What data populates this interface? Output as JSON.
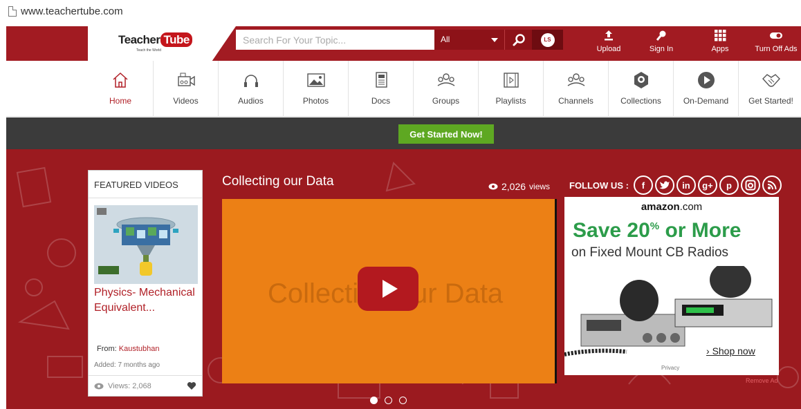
{
  "browser": {
    "url": "www.teachertube.com"
  },
  "header": {
    "logo_main": "Teacher",
    "logo_tube": "Tube",
    "logo_tagline": "Teach the World",
    "search_placeholder": "Search For Your Topic...",
    "search_category": "All",
    "ls_label": "LS",
    "actions": [
      {
        "label": "Upload",
        "icon": "upload-icon"
      },
      {
        "label": "Sign In",
        "icon": "key-icon"
      },
      {
        "label": "Apps",
        "icon": "grid-icon"
      },
      {
        "label": "Turn Off Ads",
        "icon": "toggle-icon"
      }
    ]
  },
  "nav": {
    "items": [
      {
        "label": "Home",
        "icon": "home-icon",
        "active": true
      },
      {
        "label": "Videos",
        "icon": "video-camera-icon"
      },
      {
        "label": "Audios",
        "icon": "headphones-icon"
      },
      {
        "label": "Photos",
        "icon": "photo-icon"
      },
      {
        "label": "Docs",
        "icon": "document-icon"
      },
      {
        "label": "Groups",
        "icon": "group-icon"
      },
      {
        "label": "Playlists",
        "icon": "film-icon"
      },
      {
        "label": "Channels",
        "icon": "channels-icon"
      },
      {
        "label": "Collections",
        "icon": "collection-icon"
      },
      {
        "label": "On-Demand",
        "icon": "play-circle-icon"
      },
      {
        "label": "Get Started!",
        "icon": "handshake-icon"
      }
    ]
  },
  "cta": {
    "label": "Get Started Now!"
  },
  "featured": {
    "heading": "FEATURED VIDEOS",
    "title": "Physics- Mechanical Equivalent...",
    "from_label": "From:",
    "from_user": "Kaustubhan",
    "added": "Added: 7 months ago",
    "views": "Views: 2,068"
  },
  "video": {
    "title": "Collecting our Data",
    "views_count": "2,026",
    "views_label": "views",
    "overlay_text": "Collecting our Data"
  },
  "carousel": {
    "count": 3,
    "active_index": 0
  },
  "social": {
    "label": "FOLLOW US :",
    "links": [
      "f",
      "t",
      "in",
      "g+",
      "p",
      "ig",
      "rss"
    ]
  },
  "ad": {
    "brand": "amazon",
    "brand_suffix": ".com",
    "save_prefix": "Save 20",
    "save_percent": "%",
    "save_suffix": " or More",
    "subline": "on Fixed Mount CB Radios",
    "shop": "Shop now",
    "privacy": "Privacy",
    "remove": "Remove Ad"
  },
  "colors": {
    "brand_red": "#a21b22",
    "dark_band": "#3b3b3b",
    "cta_green": "#5ea822",
    "player_orange": "#ec8015",
    "ad_green": "#2c9c4a"
  }
}
